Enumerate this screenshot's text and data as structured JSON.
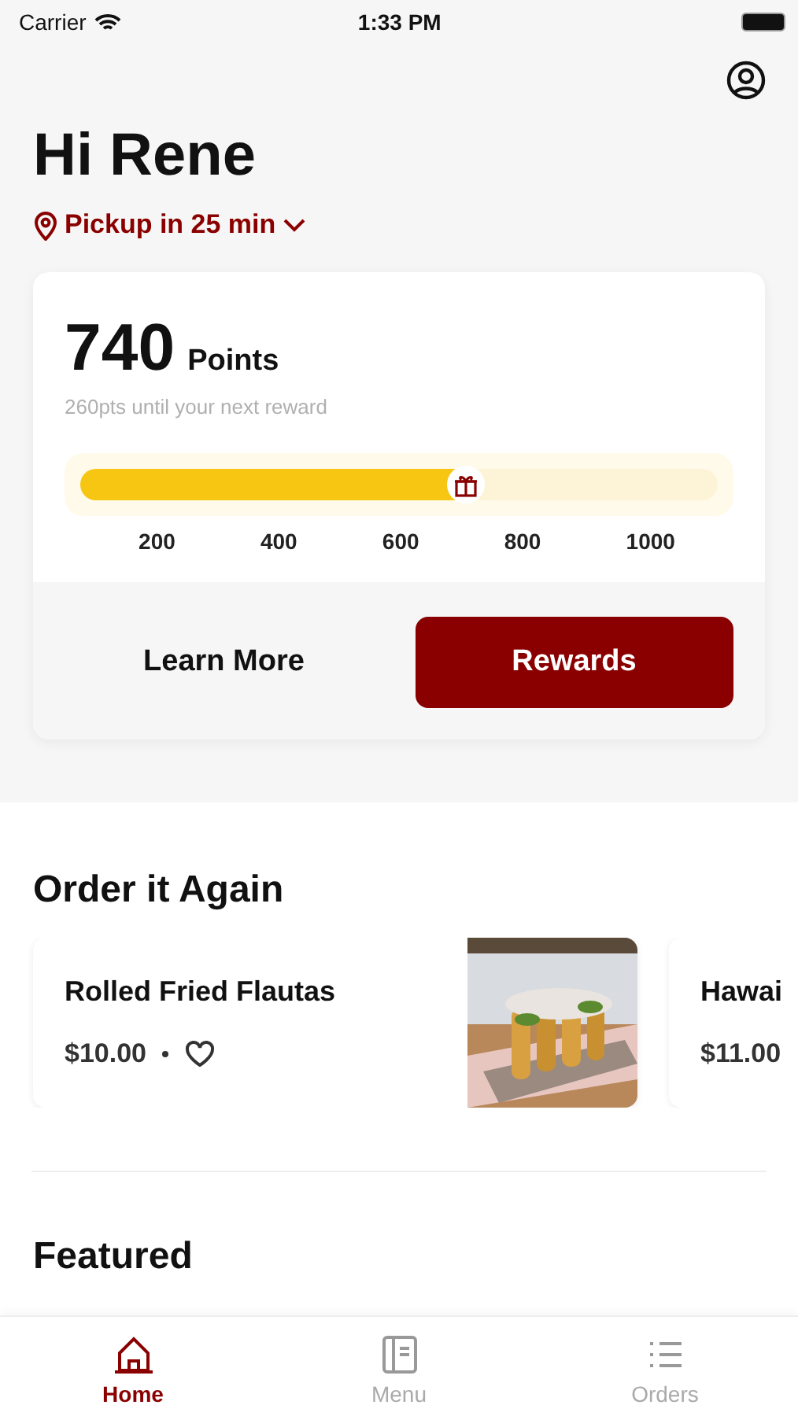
{
  "status_bar": {
    "carrier": "Carrier",
    "time": "1:33 PM"
  },
  "greeting": "Hi Rene",
  "pickup": "Pickup in 25 min",
  "rewards": {
    "points": "740",
    "points_label": "Points",
    "subtitle": "260pts until your next reward",
    "level": 0.61,
    "ticks": [
      "200",
      "400",
      "600",
      "800",
      "1000"
    ],
    "buttons": [
      {
        "label": "Learn More",
        "kind": "plain"
      },
      {
        "label": "Rewards",
        "kind": "primary"
      }
    ]
  },
  "order_again": {
    "title": "Order it Again",
    "items": [
      {
        "name": "Rolled Fried Flautas",
        "price": "$10.00",
        "favorite": false,
        "kind": "picture"
      },
      {
        "name": "Hawai",
        "price": "$11.00"
      }
    ]
  },
  "featured": {
    "title": "Featured"
  },
  "tabs": [
    {
      "label": "Home",
      "selected": true,
      "kind": "home"
    },
    {
      "label": "Menu",
      "selected": false,
      "kind": "menu"
    },
    {
      "label": "Orders",
      "selected": false,
      "kind": "orders"
    }
  ]
}
